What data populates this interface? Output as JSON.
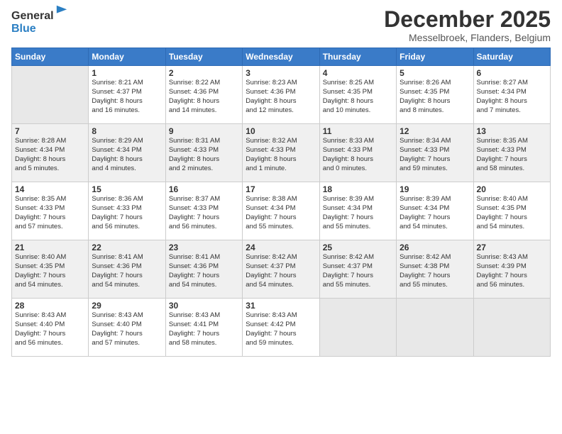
{
  "logo": {
    "general": "General",
    "blue": "Blue"
  },
  "title": "December 2025",
  "location": "Messelbroek, Flanders, Belgium",
  "days_of_week": [
    "Sunday",
    "Monday",
    "Tuesday",
    "Wednesday",
    "Thursday",
    "Friday",
    "Saturday"
  ],
  "weeks": [
    [
      {
        "day": "",
        "info": ""
      },
      {
        "day": "1",
        "info": "Sunrise: 8:21 AM\nSunset: 4:37 PM\nDaylight: 8 hours\nand 16 minutes."
      },
      {
        "day": "2",
        "info": "Sunrise: 8:22 AM\nSunset: 4:36 PM\nDaylight: 8 hours\nand 14 minutes."
      },
      {
        "day": "3",
        "info": "Sunrise: 8:23 AM\nSunset: 4:36 PM\nDaylight: 8 hours\nand 12 minutes."
      },
      {
        "day": "4",
        "info": "Sunrise: 8:25 AM\nSunset: 4:35 PM\nDaylight: 8 hours\nand 10 minutes."
      },
      {
        "day": "5",
        "info": "Sunrise: 8:26 AM\nSunset: 4:35 PM\nDaylight: 8 hours\nand 8 minutes."
      },
      {
        "day": "6",
        "info": "Sunrise: 8:27 AM\nSunset: 4:34 PM\nDaylight: 8 hours\nand 7 minutes."
      }
    ],
    [
      {
        "day": "7",
        "info": "Sunrise: 8:28 AM\nSunset: 4:34 PM\nDaylight: 8 hours\nand 5 minutes."
      },
      {
        "day": "8",
        "info": "Sunrise: 8:29 AM\nSunset: 4:34 PM\nDaylight: 8 hours\nand 4 minutes."
      },
      {
        "day": "9",
        "info": "Sunrise: 8:31 AM\nSunset: 4:33 PM\nDaylight: 8 hours\nand 2 minutes."
      },
      {
        "day": "10",
        "info": "Sunrise: 8:32 AM\nSunset: 4:33 PM\nDaylight: 8 hours\nand 1 minute."
      },
      {
        "day": "11",
        "info": "Sunrise: 8:33 AM\nSunset: 4:33 PM\nDaylight: 8 hours\nand 0 minutes."
      },
      {
        "day": "12",
        "info": "Sunrise: 8:34 AM\nSunset: 4:33 PM\nDaylight: 7 hours\nand 59 minutes."
      },
      {
        "day": "13",
        "info": "Sunrise: 8:35 AM\nSunset: 4:33 PM\nDaylight: 7 hours\nand 58 minutes."
      }
    ],
    [
      {
        "day": "14",
        "info": "Sunrise: 8:35 AM\nSunset: 4:33 PM\nDaylight: 7 hours\nand 57 minutes."
      },
      {
        "day": "15",
        "info": "Sunrise: 8:36 AM\nSunset: 4:33 PM\nDaylight: 7 hours\nand 56 minutes."
      },
      {
        "day": "16",
        "info": "Sunrise: 8:37 AM\nSunset: 4:33 PM\nDaylight: 7 hours\nand 56 minutes."
      },
      {
        "day": "17",
        "info": "Sunrise: 8:38 AM\nSunset: 4:34 PM\nDaylight: 7 hours\nand 55 minutes."
      },
      {
        "day": "18",
        "info": "Sunrise: 8:39 AM\nSunset: 4:34 PM\nDaylight: 7 hours\nand 55 minutes."
      },
      {
        "day": "19",
        "info": "Sunrise: 8:39 AM\nSunset: 4:34 PM\nDaylight: 7 hours\nand 54 minutes."
      },
      {
        "day": "20",
        "info": "Sunrise: 8:40 AM\nSunset: 4:35 PM\nDaylight: 7 hours\nand 54 minutes."
      }
    ],
    [
      {
        "day": "21",
        "info": "Sunrise: 8:40 AM\nSunset: 4:35 PM\nDaylight: 7 hours\nand 54 minutes."
      },
      {
        "day": "22",
        "info": "Sunrise: 8:41 AM\nSunset: 4:36 PM\nDaylight: 7 hours\nand 54 minutes."
      },
      {
        "day": "23",
        "info": "Sunrise: 8:41 AM\nSunset: 4:36 PM\nDaylight: 7 hours\nand 54 minutes."
      },
      {
        "day": "24",
        "info": "Sunrise: 8:42 AM\nSunset: 4:37 PM\nDaylight: 7 hours\nand 54 minutes."
      },
      {
        "day": "25",
        "info": "Sunrise: 8:42 AM\nSunset: 4:37 PM\nDaylight: 7 hours\nand 55 minutes."
      },
      {
        "day": "26",
        "info": "Sunrise: 8:42 AM\nSunset: 4:38 PM\nDaylight: 7 hours\nand 55 minutes."
      },
      {
        "day": "27",
        "info": "Sunrise: 8:43 AM\nSunset: 4:39 PM\nDaylight: 7 hours\nand 56 minutes."
      }
    ],
    [
      {
        "day": "28",
        "info": "Sunrise: 8:43 AM\nSunset: 4:40 PM\nDaylight: 7 hours\nand 56 minutes."
      },
      {
        "day": "29",
        "info": "Sunrise: 8:43 AM\nSunset: 4:40 PM\nDaylight: 7 hours\nand 57 minutes."
      },
      {
        "day": "30",
        "info": "Sunrise: 8:43 AM\nSunset: 4:41 PM\nDaylight: 7 hours\nand 58 minutes."
      },
      {
        "day": "31",
        "info": "Sunrise: 8:43 AM\nSunset: 4:42 PM\nDaylight: 7 hours\nand 59 minutes."
      },
      {
        "day": "",
        "info": ""
      },
      {
        "day": "",
        "info": ""
      },
      {
        "day": "",
        "info": ""
      }
    ]
  ]
}
